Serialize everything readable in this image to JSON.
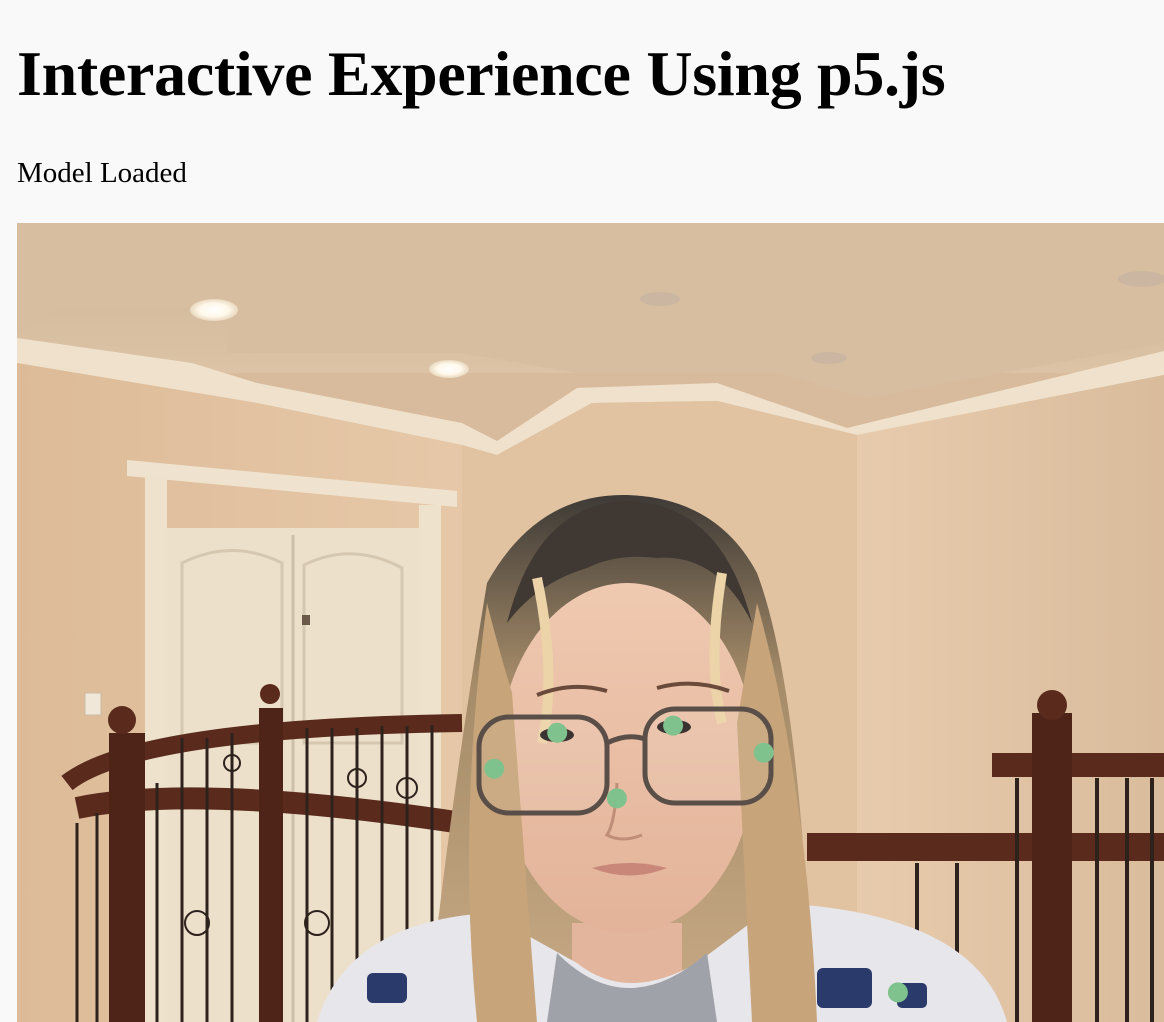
{
  "page": {
    "title": "Interactive Experience Using p5.js",
    "status": "Model Loaded"
  },
  "video": {
    "description_icon": "webcam-feed",
    "keypoint_color": "#7fc28e",
    "keypoints": [
      {
        "name": "left-eye",
        "fx": 0.471,
        "fy": 0.638
      },
      {
        "name": "right-eye",
        "fx": 0.572,
        "fy": 0.629
      },
      {
        "name": "left-ear",
        "fx": 0.416,
        "fy": 0.683
      },
      {
        "name": "right-ear",
        "fx": 0.651,
        "fy": 0.663
      },
      {
        "name": "nose",
        "fx": 0.523,
        "fy": 0.72
      },
      {
        "name": "right-shoulder",
        "fx": 0.768,
        "fy": 0.963
      }
    ]
  }
}
